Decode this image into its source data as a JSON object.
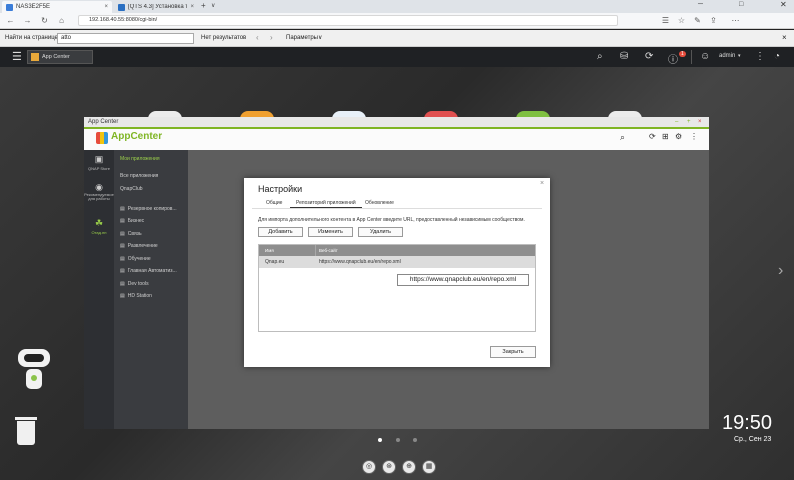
{
  "browser": {
    "tabs": [
      {
        "label": "NAS3E2F5E",
        "close": "×"
      },
      {
        "label": "[QTS 4.3] Установка торрен",
        "close": "×"
      }
    ],
    "new_tab": "+",
    "tab_menu": "∨",
    "url": "192.168.40.55:8080/cgi-bin/",
    "find": {
      "label": "Найти на странице",
      "value": "atto",
      "result": "Нет результатов",
      "options": "Параметры"
    }
  },
  "qts": {
    "user": "admin",
    "notif_count": "1"
  },
  "window": {
    "title": "App Center",
    "minimize": "–",
    "maximize": "+",
    "close": "×"
  },
  "appcenter": {
    "logo": "AppCenter",
    "left": [
      {
        "label": "QNAP Store"
      },
      {
        "label": "Рекомендуемое для работы"
      },
      {
        "label": "Отад.пн"
      }
    ],
    "nav": {
      "my_apps": "Мои приложения",
      "all_apps": "Все приложения",
      "qnapclub": "QnapClub",
      "categories": [
        "Резервное копиров...",
        "Бизнес",
        "Связь",
        "Развлечение",
        "Обучение",
        "Главная Автоматиз...",
        "Dev tools",
        "HD Station"
      ]
    }
  },
  "dialog": {
    "title": "Настройки",
    "tabs": [
      "Общие",
      "Репозиторий приложений",
      "Обновление"
    ],
    "description": "Для импорта дополнительного контента в App Center введите URL, предоставленный независимым сообществом.",
    "buttons": {
      "add": "Добавить",
      "edit": "Изменить",
      "delete": "Удалить",
      "close": "Закрыть"
    },
    "columns": [
      "Имя",
      "Веб-сайт"
    ],
    "rows": [
      {
        "name": "Qnap.eu",
        "site": "https://www.qnapclub.eu/en/repo.xml"
      }
    ],
    "tooltip": "https://www.qnapclub.eu/en/repo.xml"
  },
  "clock": {
    "time": "19:50",
    "date": "Ср., Сен 23"
  }
}
